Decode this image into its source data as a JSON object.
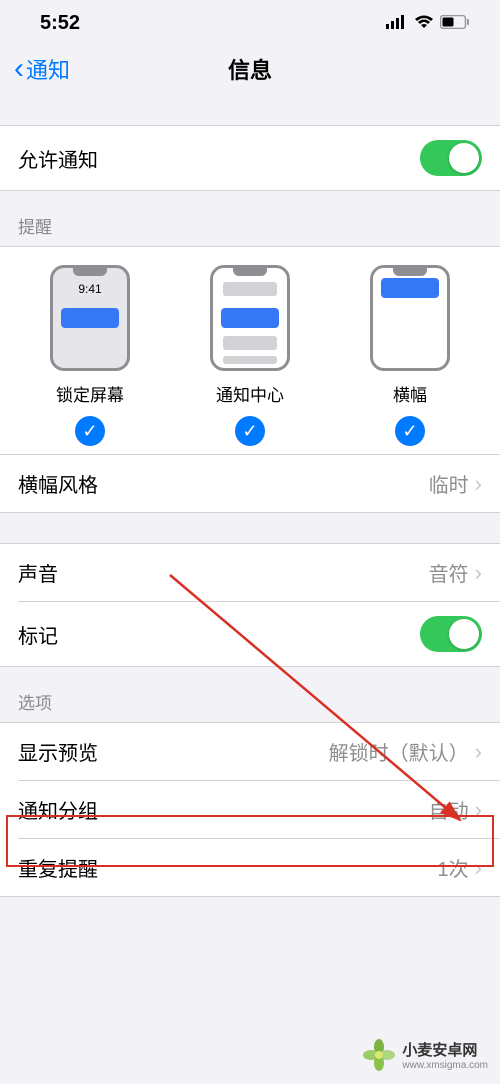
{
  "statusBar": {
    "time": "5:52"
  },
  "nav": {
    "back": "通知",
    "title": "信息"
  },
  "allowNotifications": {
    "label": "允许通知"
  },
  "alertsHeader": "提醒",
  "alerts": {
    "lockTime": "9:41",
    "lockScreen": "锁定屏幕",
    "notificationCenter": "通知中心",
    "banners": "横幅"
  },
  "bannerStyle": {
    "label": "横幅风格",
    "value": "临时"
  },
  "sounds": {
    "label": "声音",
    "value": "音符"
  },
  "badges": {
    "label": "标记"
  },
  "optionsHeader": "选项",
  "showPreviews": {
    "label": "显示预览",
    "value": "解锁时（默认）"
  },
  "grouping": {
    "label": "通知分组",
    "value": "自动"
  },
  "repeat": {
    "label": "重复提醒",
    "value": "1次"
  },
  "watermark": {
    "name": "小麦安卓网",
    "url": "www.xmsigma.com"
  }
}
